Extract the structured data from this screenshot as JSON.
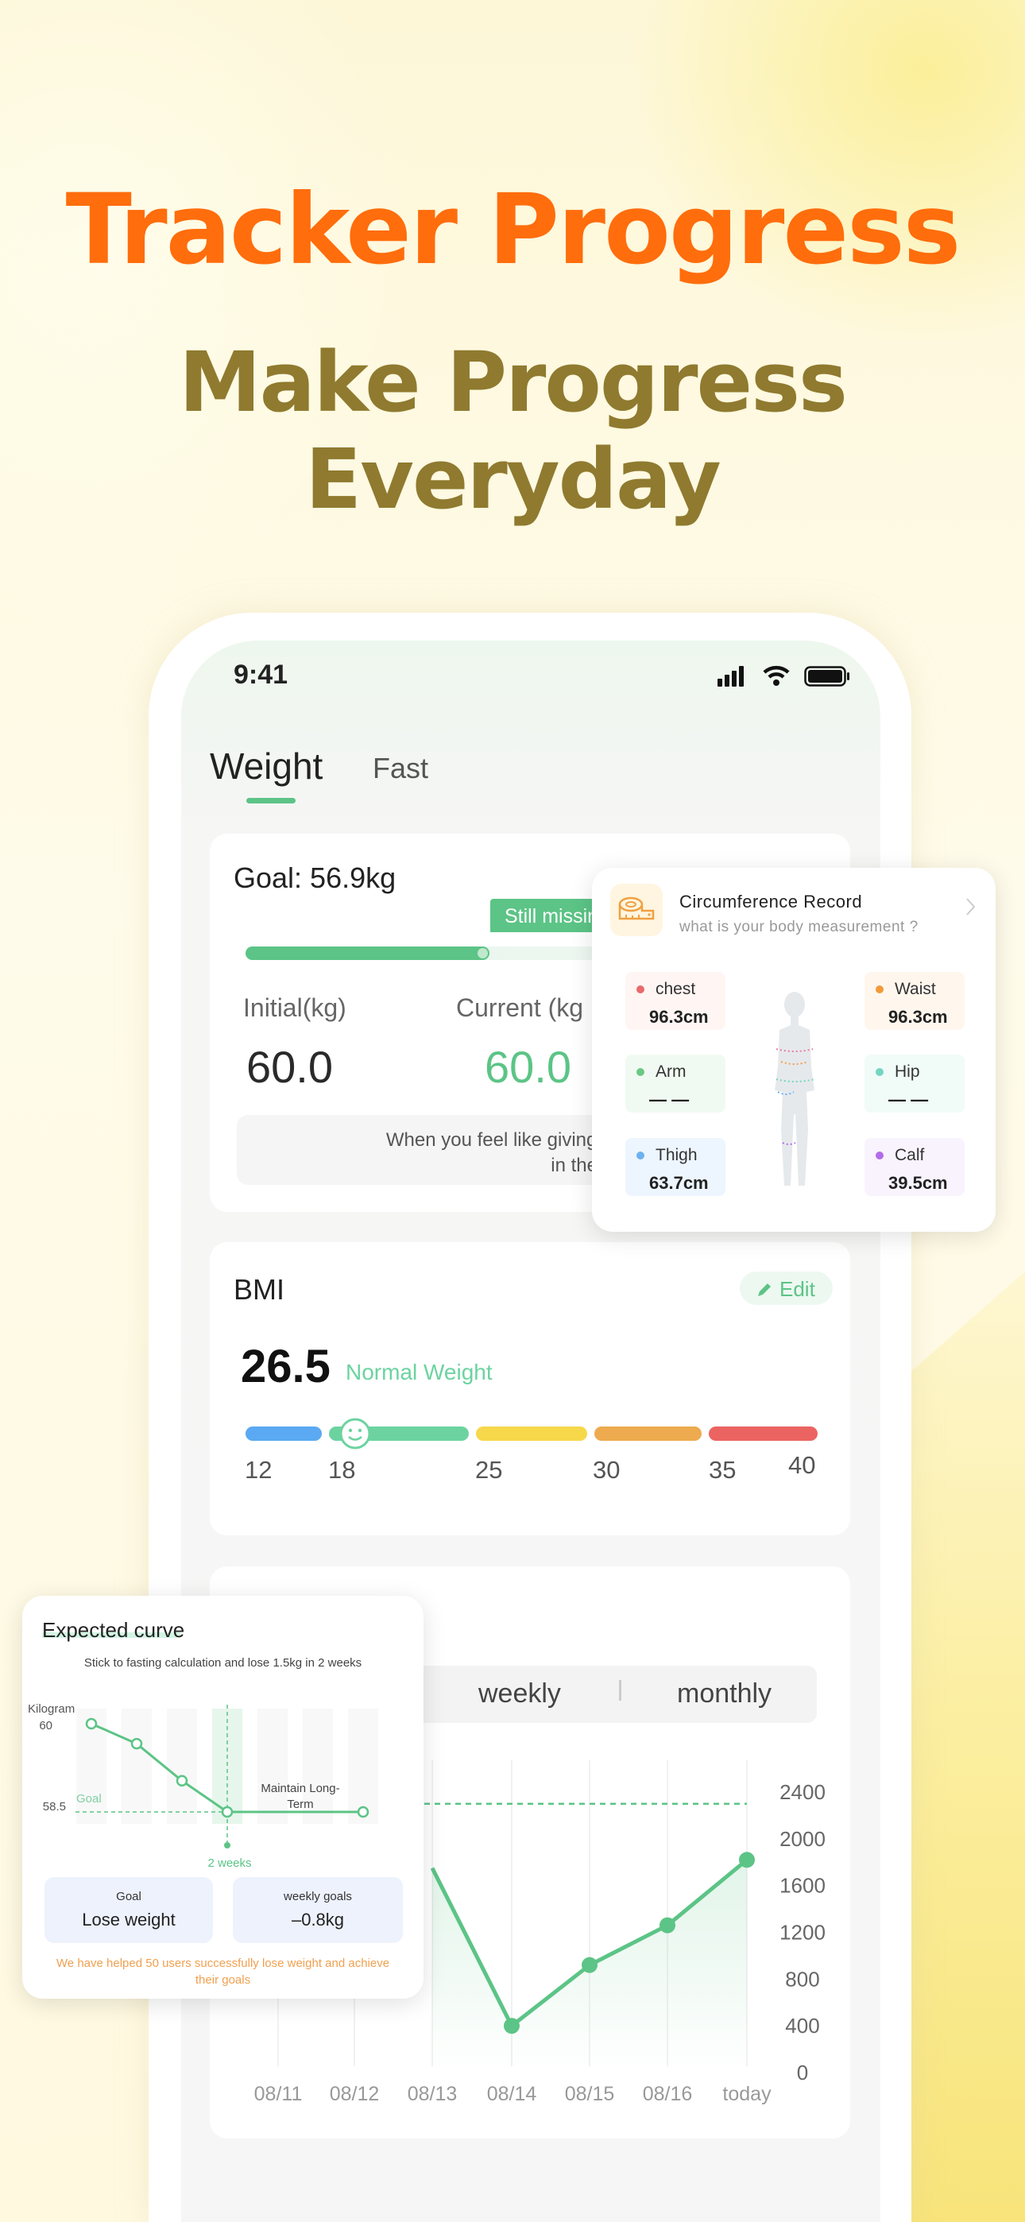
{
  "hero": {
    "title": "Tracker Progress",
    "subtitle_line1": "Make Progress",
    "subtitle_line2": "Everyday"
  },
  "status_bar": {
    "time": "9:41",
    "icons": [
      "cellular-signal-icon",
      "wifi-icon",
      "battery-icon"
    ]
  },
  "tabs": [
    {
      "label": "Weight",
      "active": true
    },
    {
      "label": "Fast",
      "active": false
    }
  ],
  "goal_card": {
    "goal": "Goal: 56.9kg",
    "tag": "Still missin",
    "progress": 0.42,
    "initial_label": "Initial(kg)",
    "initial_value": "60.0",
    "current_label": "Current (kg",
    "current_value": "60.0",
    "quote_line1": "When you feel like giving up, think ab",
    "quote_line2": "in the first place?"
  },
  "bmi_card": {
    "title": "BMI",
    "edit_label": "Edit",
    "value": "26.5",
    "status": "Normal Weight",
    "marker_value": 19.3,
    "ticks": [
      "12",
      "18",
      "25",
      "30",
      "35",
      "40"
    ],
    "segment_colors": [
      "#5aa9f2",
      "#6cd3a0",
      "#f6d84a",
      "#eeaa4e",
      "#ec6461"
    ]
  },
  "trend_card": {
    "segments": [
      "weekly",
      "monthly"
    ]
  },
  "circumference": {
    "title": "Circumference Record",
    "subtitle": "what is your body measurement ?",
    "items": [
      {
        "label": "chest",
        "value": "96.3cm",
        "color": "#e86a6a",
        "bg": "#fff6f4"
      },
      {
        "label": "Waist",
        "value": "96.3cm",
        "color": "#f29a3a",
        "bg": "#fff7ee"
      },
      {
        "label": "Arm",
        "value": "— —",
        "color": "#6cc884",
        "bg": "#f1faf2"
      },
      {
        "label": "Hip",
        "value": "— —",
        "color": "#74d6bf",
        "bg": "#f1fbf8"
      },
      {
        "label": "Thigh",
        "value": "63.7cm",
        "color": "#6cb2f0",
        "bg": "#edf5fe"
      },
      {
        "label": "Calf",
        "value": "39.5cm",
        "color": "#b36be8",
        "bg": "#f9f3fe"
      }
    ]
  },
  "expected": {
    "title": "Expected curve",
    "subtitle": "Stick to fasting calculation and lose 1.5kg in 2 weeks",
    "goal_box_label": "Goal",
    "goal_box_value": "Lose weight",
    "weekly_box_label": "weekly goals",
    "weekly_box_value": "–0.8kg",
    "notice": "We have helped 50 users successfully lose weight and achieve their goals"
  },
  "chart_data": [
    {
      "type": "line",
      "categories": [
        "08/11",
        "08/12",
        "08/13",
        "08/14",
        "08/15",
        "08/16",
        "today"
      ],
      "values": [
        null,
        null,
        1750,
        400,
        920,
        1260,
        1820
      ],
      "reference_line": 2300,
      "yticks": [
        "0",
        "400",
        "800",
        "1200",
        "1600",
        "2000",
        "2400"
      ],
      "ylim": [
        0,
        2400
      ],
      "grid": "vertical",
      "color": "#5cc486"
    },
    {
      "type": "line",
      "title": "Expected curve",
      "ylabel": "Kilogram",
      "yticks": [
        "60",
        "58.5"
      ],
      "x": [
        0,
        1,
        2,
        3,
        6
      ],
      "values": [
        60,
        59.66,
        59.03,
        58.5,
        58.5
      ],
      "goal_label": "Goal",
      "goal_value": 58.5,
      "marker_label": "2 weeks",
      "annotation": "Maintain Long-Term",
      "color": "#5cc486"
    }
  ],
  "colors": {
    "accent": "#5cc486",
    "title_orange": "#ff6d0c",
    "title_olive": "#8f7a2f",
    "notice_orange": "#f0a050"
  }
}
